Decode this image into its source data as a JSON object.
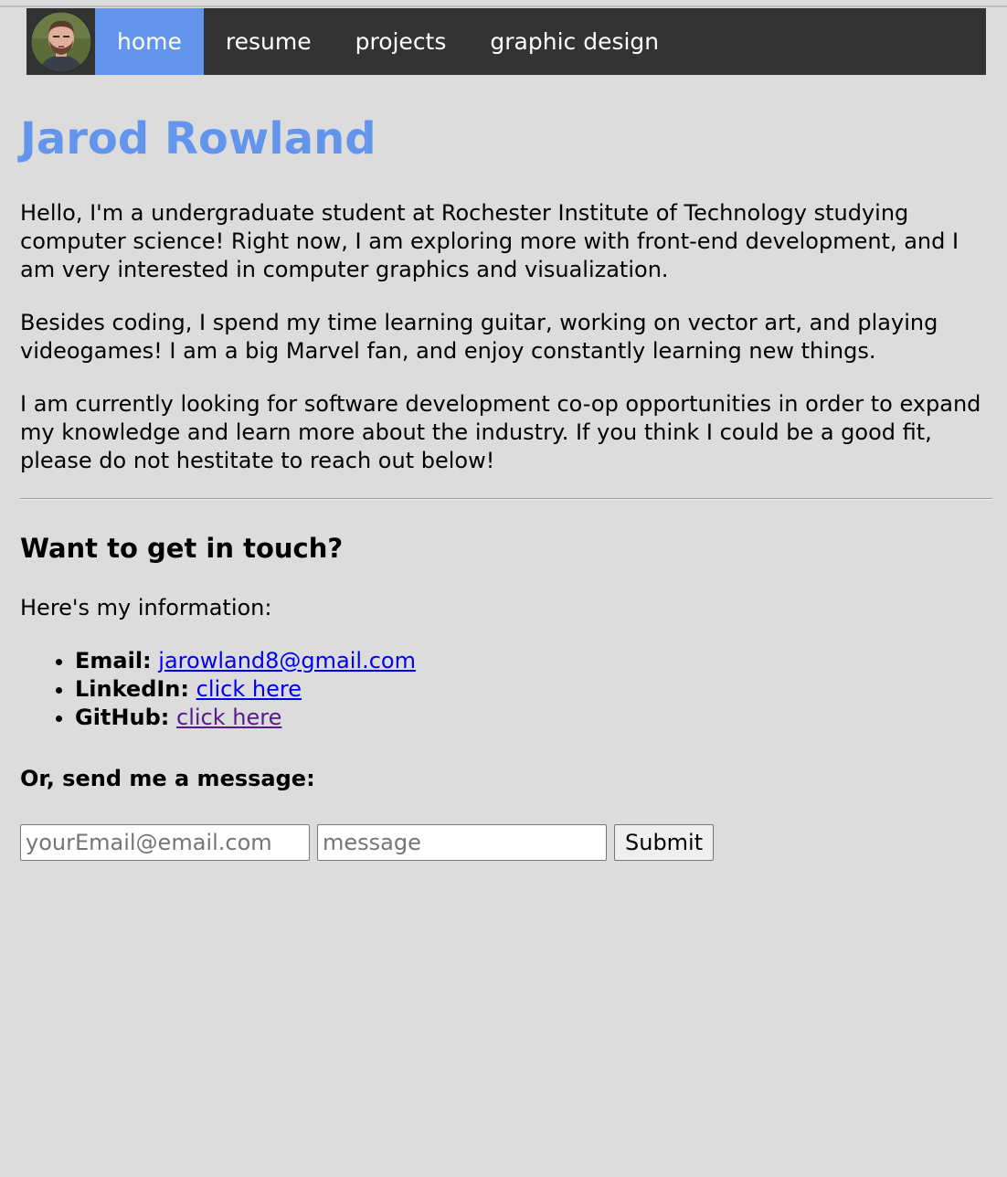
{
  "nav": {
    "items": [
      {
        "label": "home",
        "active": true
      },
      {
        "label": "resume",
        "active": false
      },
      {
        "label": "projects",
        "active": false
      },
      {
        "label": "graphic design",
        "active": false
      }
    ]
  },
  "header": {
    "name": "Jarod Rowland"
  },
  "about": {
    "paragraphs": [
      "Hello, I'm a undergraduate student at Rochester Institute of Technology studying computer science! Right now, I am exploring more with front-end development, and I am very interested in computer graphics and visualization.",
      "Besides coding, I spend my time learning guitar, working on vector art, and playing videogames! I am a big Marvel fan, and enjoy constantly learning new things.",
      "I am currently looking for software development co-op opportunities in order to expand my knowledge and learn more about the industry. If you think I could be a good fit, please do not hestitate to reach out below!"
    ]
  },
  "contact": {
    "heading": "Want to get in touch?",
    "intro": "Here's my information:",
    "items": [
      {
        "label": "Email:",
        "link_text": "jarowland8@gmail.com"
      },
      {
        "label": "LinkedIn:",
        "link_text": "click here"
      },
      {
        "label": "GitHub:",
        "link_text": "click here"
      }
    ],
    "message_heading": "Or, send me a message:",
    "email_placeholder": "yourEmail@email.com",
    "message_placeholder": "message",
    "submit_label": "Submit"
  },
  "colors": {
    "accent": "#6495ed",
    "navbar": "#333333",
    "background": "#dcdcdc",
    "link": "#0000ee",
    "visited_link": "#551a8b"
  }
}
